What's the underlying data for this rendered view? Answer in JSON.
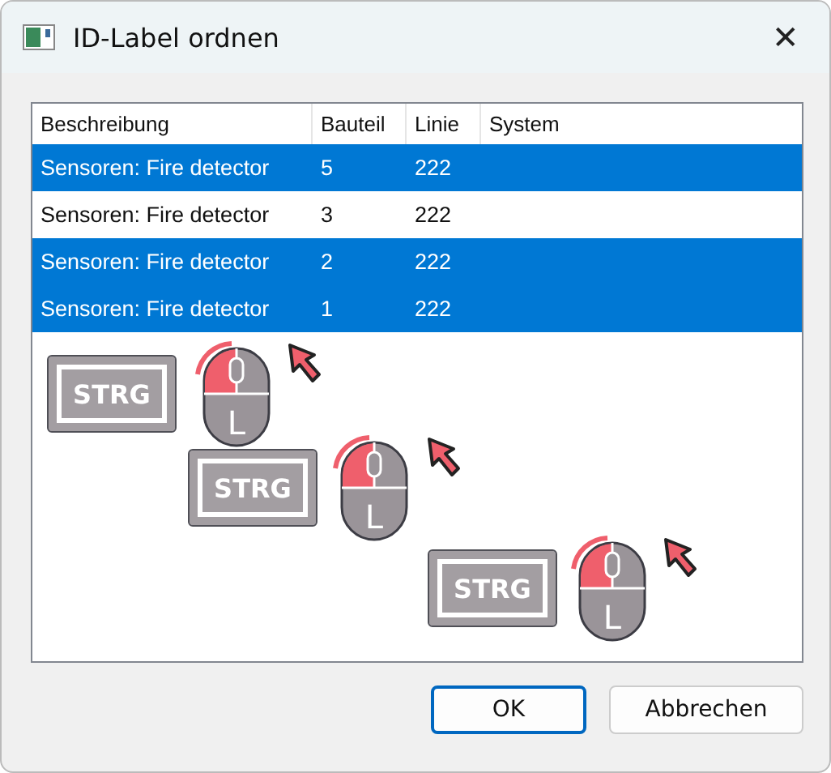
{
  "window": {
    "title": "ID-Label ordnen",
    "close": "✕"
  },
  "table": {
    "columns": [
      "Beschreibung",
      "Bauteil",
      "Linie",
      "System"
    ],
    "rows": [
      {
        "cells": [
          "Sensoren: Fire detector",
          "5",
          "222",
          ""
        ],
        "selected": true
      },
      {
        "cells": [
          "Sensoren: Fire detector",
          "3",
          "222",
          ""
        ],
        "selected": false
      },
      {
        "cells": [
          "Sensoren: Fire detector",
          "2",
          "222",
          ""
        ],
        "selected": true
      },
      {
        "cells": [
          "Sensoren: Fire detector",
          "1",
          "222",
          ""
        ],
        "selected": true
      }
    ]
  },
  "gesture_hints": [
    {
      "key": "STRG",
      "button": "L"
    },
    {
      "key": "STRG",
      "button": "L"
    },
    {
      "key": "STRG",
      "button": "L"
    }
  ],
  "buttons": [
    {
      "label": "OK",
      "kind": "default"
    },
    {
      "label": "Abbrechen",
      "kind": "normal"
    }
  ]
}
